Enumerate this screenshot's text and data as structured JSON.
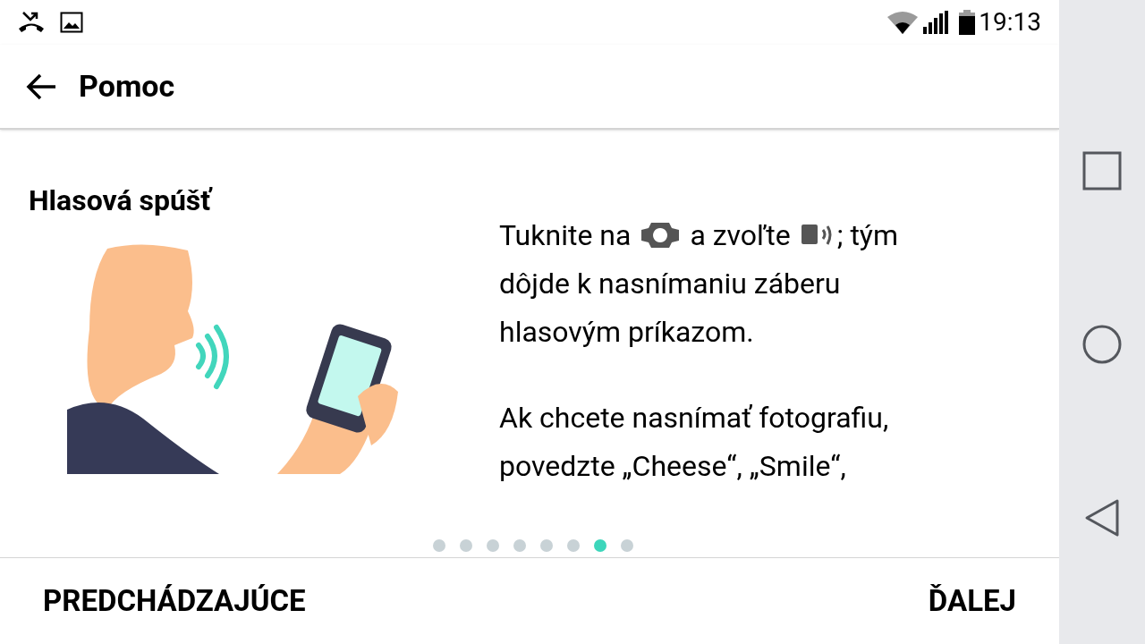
{
  "status_bar": {
    "time": "19:13"
  },
  "app_bar": {
    "title": "Pomoc"
  },
  "page": {
    "title": "Hlasová spúšť",
    "paragraphs": [
      [
        [
          {
            "kind": "text",
            "text": "Tuknite na"
          },
          {
            "kind": "gear"
          },
          {
            "kind": "text",
            "text": "a zvoľte"
          },
          {
            "kind": "voice"
          },
          {
            "kind": "text",
            "text": "; tým"
          }
        ],
        [
          {
            "kind": "text",
            "text": "dôjde k nasnímaniu záberu hlasovým príkazom."
          }
        ]
      ],
      [
        [
          {
            "kind": "text",
            "text": "Ak chcete nasnímať fotografiu, povedzte „Cheese“, „Smile“,"
          }
        ]
      ]
    ]
  },
  "pager": [
    {
      "selected": false
    },
    {
      "selected": false
    },
    {
      "selected": false
    },
    {
      "selected": false
    },
    {
      "selected": false
    },
    {
      "selected": false
    },
    {
      "selected": true
    },
    {
      "selected": false
    }
  ],
  "buttons": {
    "previous": "PREDCHÁDZAJÚCE",
    "next": "ĎALEJ"
  }
}
